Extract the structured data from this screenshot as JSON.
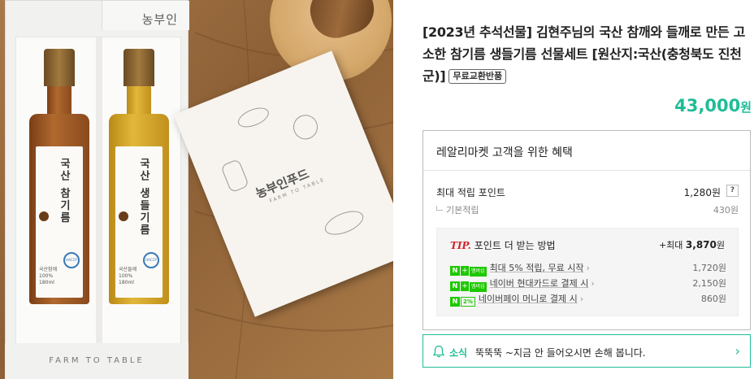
{
  "image": {
    "box_brand": "농부인",
    "box_footer": "FARM TO TABLE",
    "bottles": [
      {
        "name": "국산 참기름",
        "content": "국산참깨\n100%\n180ml"
      },
      {
        "name": "국산 생들기름",
        "content": "국산들깨\n100%\n180ml"
      }
    ],
    "haccp": "HACCP",
    "brochure_logo": "농부인푸드",
    "brochure_sub": "FARM TO TABLE"
  },
  "product": {
    "title": "[2023년 추석선물] 김현주님의 국산 참깨와 들깨로 만든 고소한 참기름 생들기름 선물세트 [원산지:국산(충청북도 진천군)]",
    "badge": "무료교환반품",
    "price": "43,000",
    "price_unit": "원"
  },
  "benefits": {
    "heading": "레알리마켓 고객을 위한 혜택",
    "max_points_label": "최대 적립 포인트",
    "max_points_value": "1,280원",
    "help_glyph": "?",
    "basic_label": "기본적립",
    "basic_value": "430원",
    "tip": {
      "tag": "TIP.",
      "heading": "포인트 더 받는 방법",
      "total_prefix": "+최대",
      "total_value": "3,870",
      "total_unit": "원",
      "items": [
        {
          "badge": "membership",
          "text": "최대 5% 적립, 무료 시작",
          "value": "1,720원"
        },
        {
          "badge": "membership",
          "text": "네이버 현대카드로 결제 시",
          "value": "2,150원"
        },
        {
          "badge": "2%",
          "text": "네이버페이 머니로 결제 시",
          "value": "860원"
        }
      ],
      "badge_n": "N",
      "badge_plus": "+",
      "badge_membership": "멤버십"
    }
  },
  "news": {
    "label": "소식",
    "text": "뚝뚝뚝 ~지금 안 들어오시면 손해 봅니다.",
    "chevron": "›"
  },
  "colors": {
    "accent": "#1fbd96",
    "tip_red": "#d4232b",
    "naver_green": "#1ec800"
  }
}
